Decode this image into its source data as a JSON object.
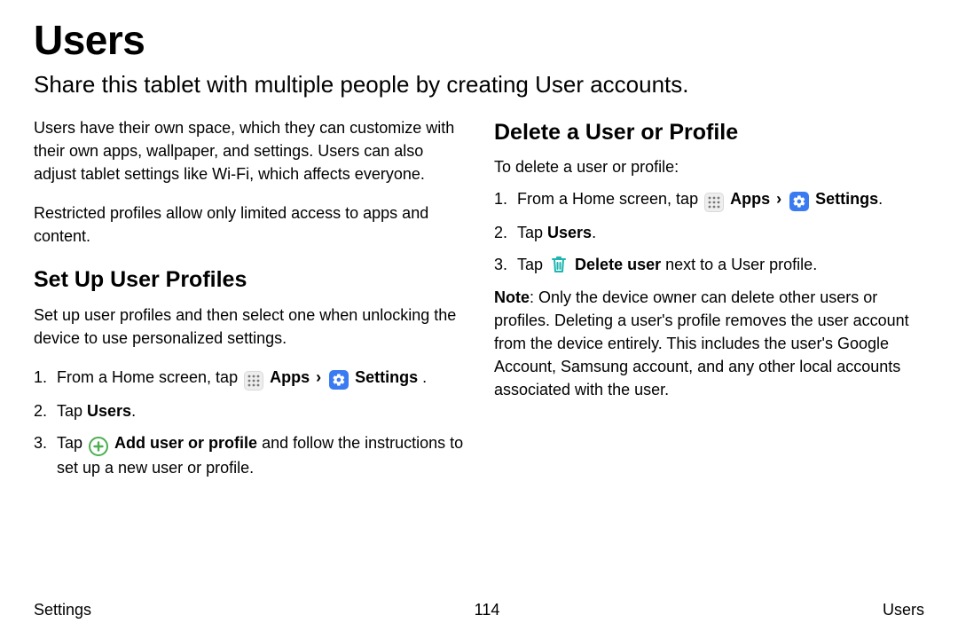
{
  "title": "Users",
  "intro": "Share this tablet with multiple people by creating User accounts.",
  "left": {
    "p1": "Users have their own space, which they can customize with their own apps, wallpaper, and settings. Users can also adjust tablet settings like Wi-Fi, which affects everyone.",
    "p2": "Restricted profiles allow only limited access to apps and content.",
    "h2": "Set Up User Profiles",
    "lead": "Set up user profiles and then select one when unlocking the device to use personalized settings.",
    "step1_pre": "From a Home screen, tap ",
    "apps_label": "Apps",
    "chev": "›",
    "settings_label": "Settings",
    "step1_post": " .",
    "step2_pre": "Tap ",
    "step2_b": "Users",
    "step2_post": ".",
    "step3_pre": "Tap ",
    "step3_b": "Add user or profile",
    "step3_post": "  and follow the instructions to set up a new user or profile."
  },
  "right": {
    "h2": "Delete a User or Profile",
    "lead": "To delete a user or profile:",
    "step1_pre": "From a Home screen, tap ",
    "apps_label": "Apps",
    "chev": "›",
    "settings_label": "Settings",
    "step1_post": ".",
    "step2_pre": "Tap ",
    "step2_b": "Users",
    "step2_post": ".",
    "step3_pre": "Tap ",
    "step3_b": "Delete user",
    "step3_post": " next to a User profile.",
    "note_label": "Note",
    "note_body": ": Only the device owner can delete other users or profiles. Deleting a user's profile removes the user account from the device entirely. This includes the user's Google Account, Samsung account, and any other local accounts associated with the user."
  },
  "footer": {
    "left": "Settings",
    "center": "114",
    "right": "Users"
  }
}
